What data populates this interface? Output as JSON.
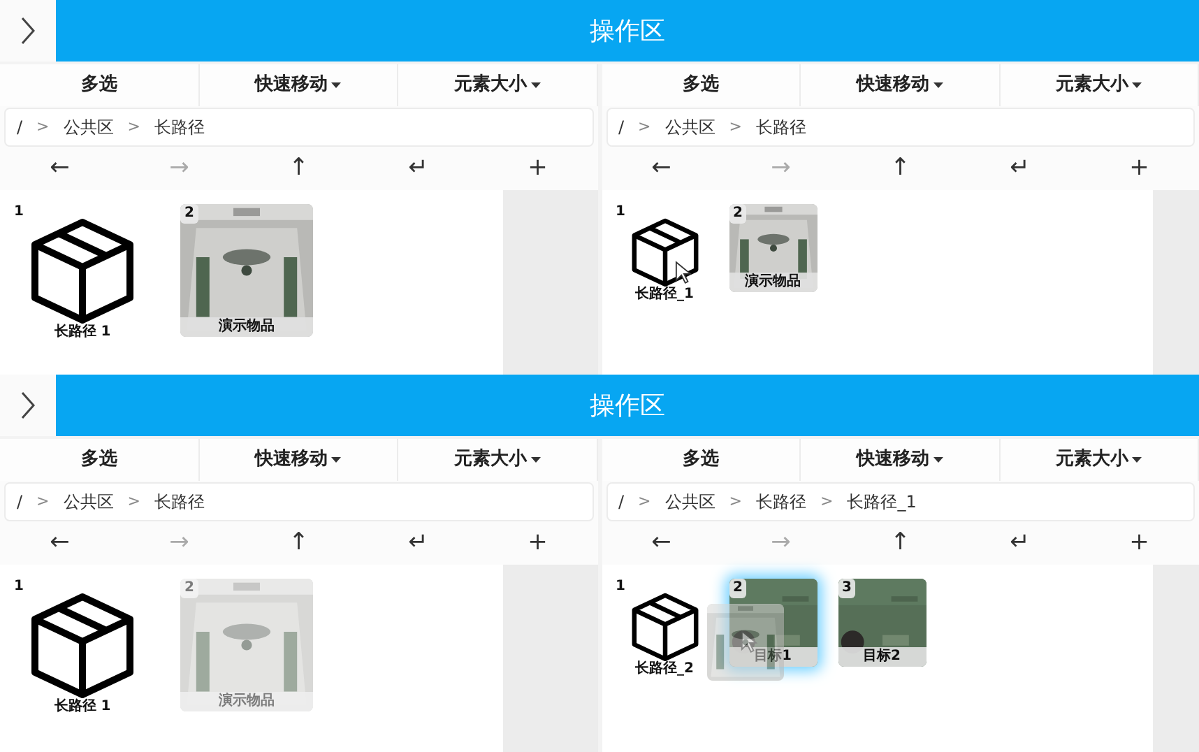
{
  "frames": [
    {
      "title": "操作区",
      "panels": [
        {
          "compact": false,
          "toolbar": [
            {
              "label": "多选",
              "dropdown": false
            },
            {
              "label": "快速移动",
              "dropdown": true
            },
            {
              "label": "元素大小",
              "dropdown": true
            }
          ],
          "breadcrumb": {
            "separator": ">",
            "parts": [
              "/",
              "公共区",
              "长路径"
            ]
          },
          "nav": [
            {
              "symbol": "←",
              "disabled": false
            },
            {
              "symbol": "→",
              "disabled": true
            },
            {
              "symbol": "↑",
              "disabled": false
            },
            {
              "symbol": "↵",
              "disabled": false
            },
            {
              "symbol": "+",
              "disabled": false
            }
          ],
          "items": [
            {
              "kind": "folder",
              "number": "1",
              "label": "长路径 1"
            },
            {
              "number": "2",
              "label": "演示物品"
            }
          ]
        },
        {
          "compact": true,
          "toolbar": [
            {
              "label": "多选",
              "dropdown": false
            },
            {
              "label": "快速移动",
              "dropdown": true
            },
            {
              "label": "元素大小",
              "dropdown": true
            }
          ],
          "breadcrumb": {
            "separator": ">",
            "parts": [
              "/",
              "公共区",
              "长路径"
            ]
          },
          "nav": [
            {
              "symbol": "←",
              "disabled": false
            },
            {
              "symbol": "→",
              "disabled": true
            },
            {
              "symbol": "↑",
              "disabled": false
            },
            {
              "symbol": "↵",
              "disabled": false
            },
            {
              "symbol": "+",
              "disabled": false
            }
          ],
          "items": [
            {
              "kind": "folder",
              "number": "1",
              "label": "长路径_1",
              "hovered": true
            },
            {
              "number": "2",
              "label": "演示物品"
            }
          ]
        }
      ]
    },
    {
      "title": "操作区",
      "panels": [
        {
          "compact": false,
          "toolbar": [
            {
              "label": "多选",
              "dropdown": false
            },
            {
              "label": "快速移动",
              "dropdown": true
            },
            {
              "label": "元素大小",
              "dropdown": true
            }
          ],
          "breadcrumb": {
            "separator": ">",
            "parts": [
              "/",
              "公共区",
              "长路径"
            ]
          },
          "nav": [
            {
              "symbol": "←",
              "disabled": false
            },
            {
              "symbol": "→",
              "disabled": true
            },
            {
              "symbol": "↑",
              "disabled": false
            },
            {
              "symbol": "↵",
              "disabled": false
            },
            {
              "symbol": "+",
              "disabled": false
            }
          ],
          "items": [
            {
              "kind": "folder",
              "number": "1",
              "label": "长路径 1"
            },
            {
              "number": "2",
              "label": "演示物品",
              "faded": true
            }
          ]
        },
        {
          "compact": true,
          "toolbar": [
            {
              "label": "多选",
              "dropdown": false
            },
            {
              "label": "快速移动",
              "dropdown": true
            },
            {
              "label": "元素大小",
              "dropdown": true
            }
          ],
          "breadcrumb": {
            "separator": ">",
            "parts": [
              "/",
              "公共区",
              "长路径",
              "长路径_1"
            ]
          },
          "nav": [
            {
              "symbol": "←",
              "disabled": false
            },
            {
              "symbol": "→",
              "disabled": true
            },
            {
              "symbol": "↑",
              "disabled": false
            },
            {
              "symbol": "↵",
              "disabled": false
            },
            {
              "symbol": "+",
              "disabled": false
            }
          ],
          "items": [
            {
              "kind": "folder",
              "number": "1",
              "label": "长路径_2"
            },
            {
              "kind": "screenshot",
              "number": "2",
              "label": "目标1",
              "hovered": true,
              "drop_target": true
            },
            {
              "kind": "screenshot",
              "number": "3",
              "label": "目标2"
            }
          ],
          "drag_ghost": true
        }
      ]
    }
  ]
}
